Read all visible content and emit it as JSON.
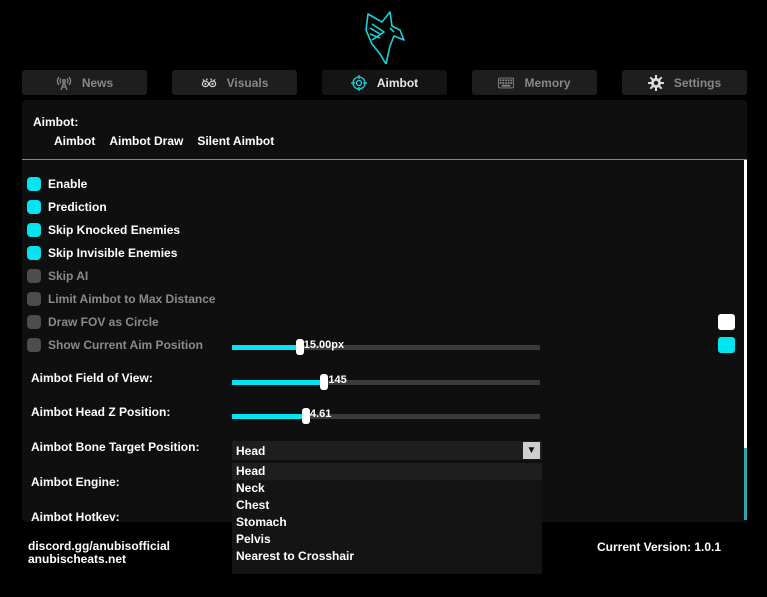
{
  "tabs": [
    {
      "label": "News",
      "icon": "broadcast-icon"
    },
    {
      "label": "Visuals",
      "icon": "eyes-icon"
    },
    {
      "label": "Aimbot",
      "icon": "crosshair-icon",
      "active": true
    },
    {
      "label": "Memory",
      "icon": "keyboard-icon"
    },
    {
      "label": "Settings",
      "icon": "gear-icon"
    }
  ],
  "section_title": "Aimbot:",
  "subtabs": [
    "Aimbot",
    "Aimbot Draw",
    "Silent Aimbot"
  ],
  "options": [
    {
      "label": "Enable",
      "checked": true
    },
    {
      "label": "Prediction",
      "checked": true
    },
    {
      "label": "Skip Knocked Enemies",
      "checked": true
    },
    {
      "label": "Skip Invisible Enemies",
      "checked": true
    },
    {
      "label": "Skip AI",
      "checked": false
    },
    {
      "label": "Limit Aimbot to Max Distance",
      "checked": false
    },
    {
      "label": "Draw FOV as Circle",
      "checked": false
    },
    {
      "label": "Show Current Aim Position",
      "checked": false
    }
  ],
  "sliders": {
    "aim_position": {
      "value": "15.00px",
      "fraction": 0.22
    },
    "fov": {
      "label": "Aimbot Field of View:",
      "value": "145",
      "fraction": 0.3
    },
    "head_z": {
      "label": "Aimbot Head Z Position:",
      "value": "4.61",
      "fraction": 0.24
    }
  },
  "bone_target": {
    "label": "Aimbot Bone Target Position:",
    "selected": "Head",
    "options": [
      "Head",
      "Neck",
      "Chest",
      "Stomach",
      "Pelvis",
      "Nearest to Crosshair"
    ]
  },
  "engine_label": "Aimbot Engine:",
  "hotkey_label": "Aimbot Hotkey:",
  "swatch_colors": [
    "#ffffff",
    "#00e5f2"
  ],
  "accent_color": "#00e5f2",
  "footer": {
    "discord": "discord.gg/anubisofficial",
    "site": "anubischeats.net",
    "version": "Current Version: 1.0.1"
  }
}
